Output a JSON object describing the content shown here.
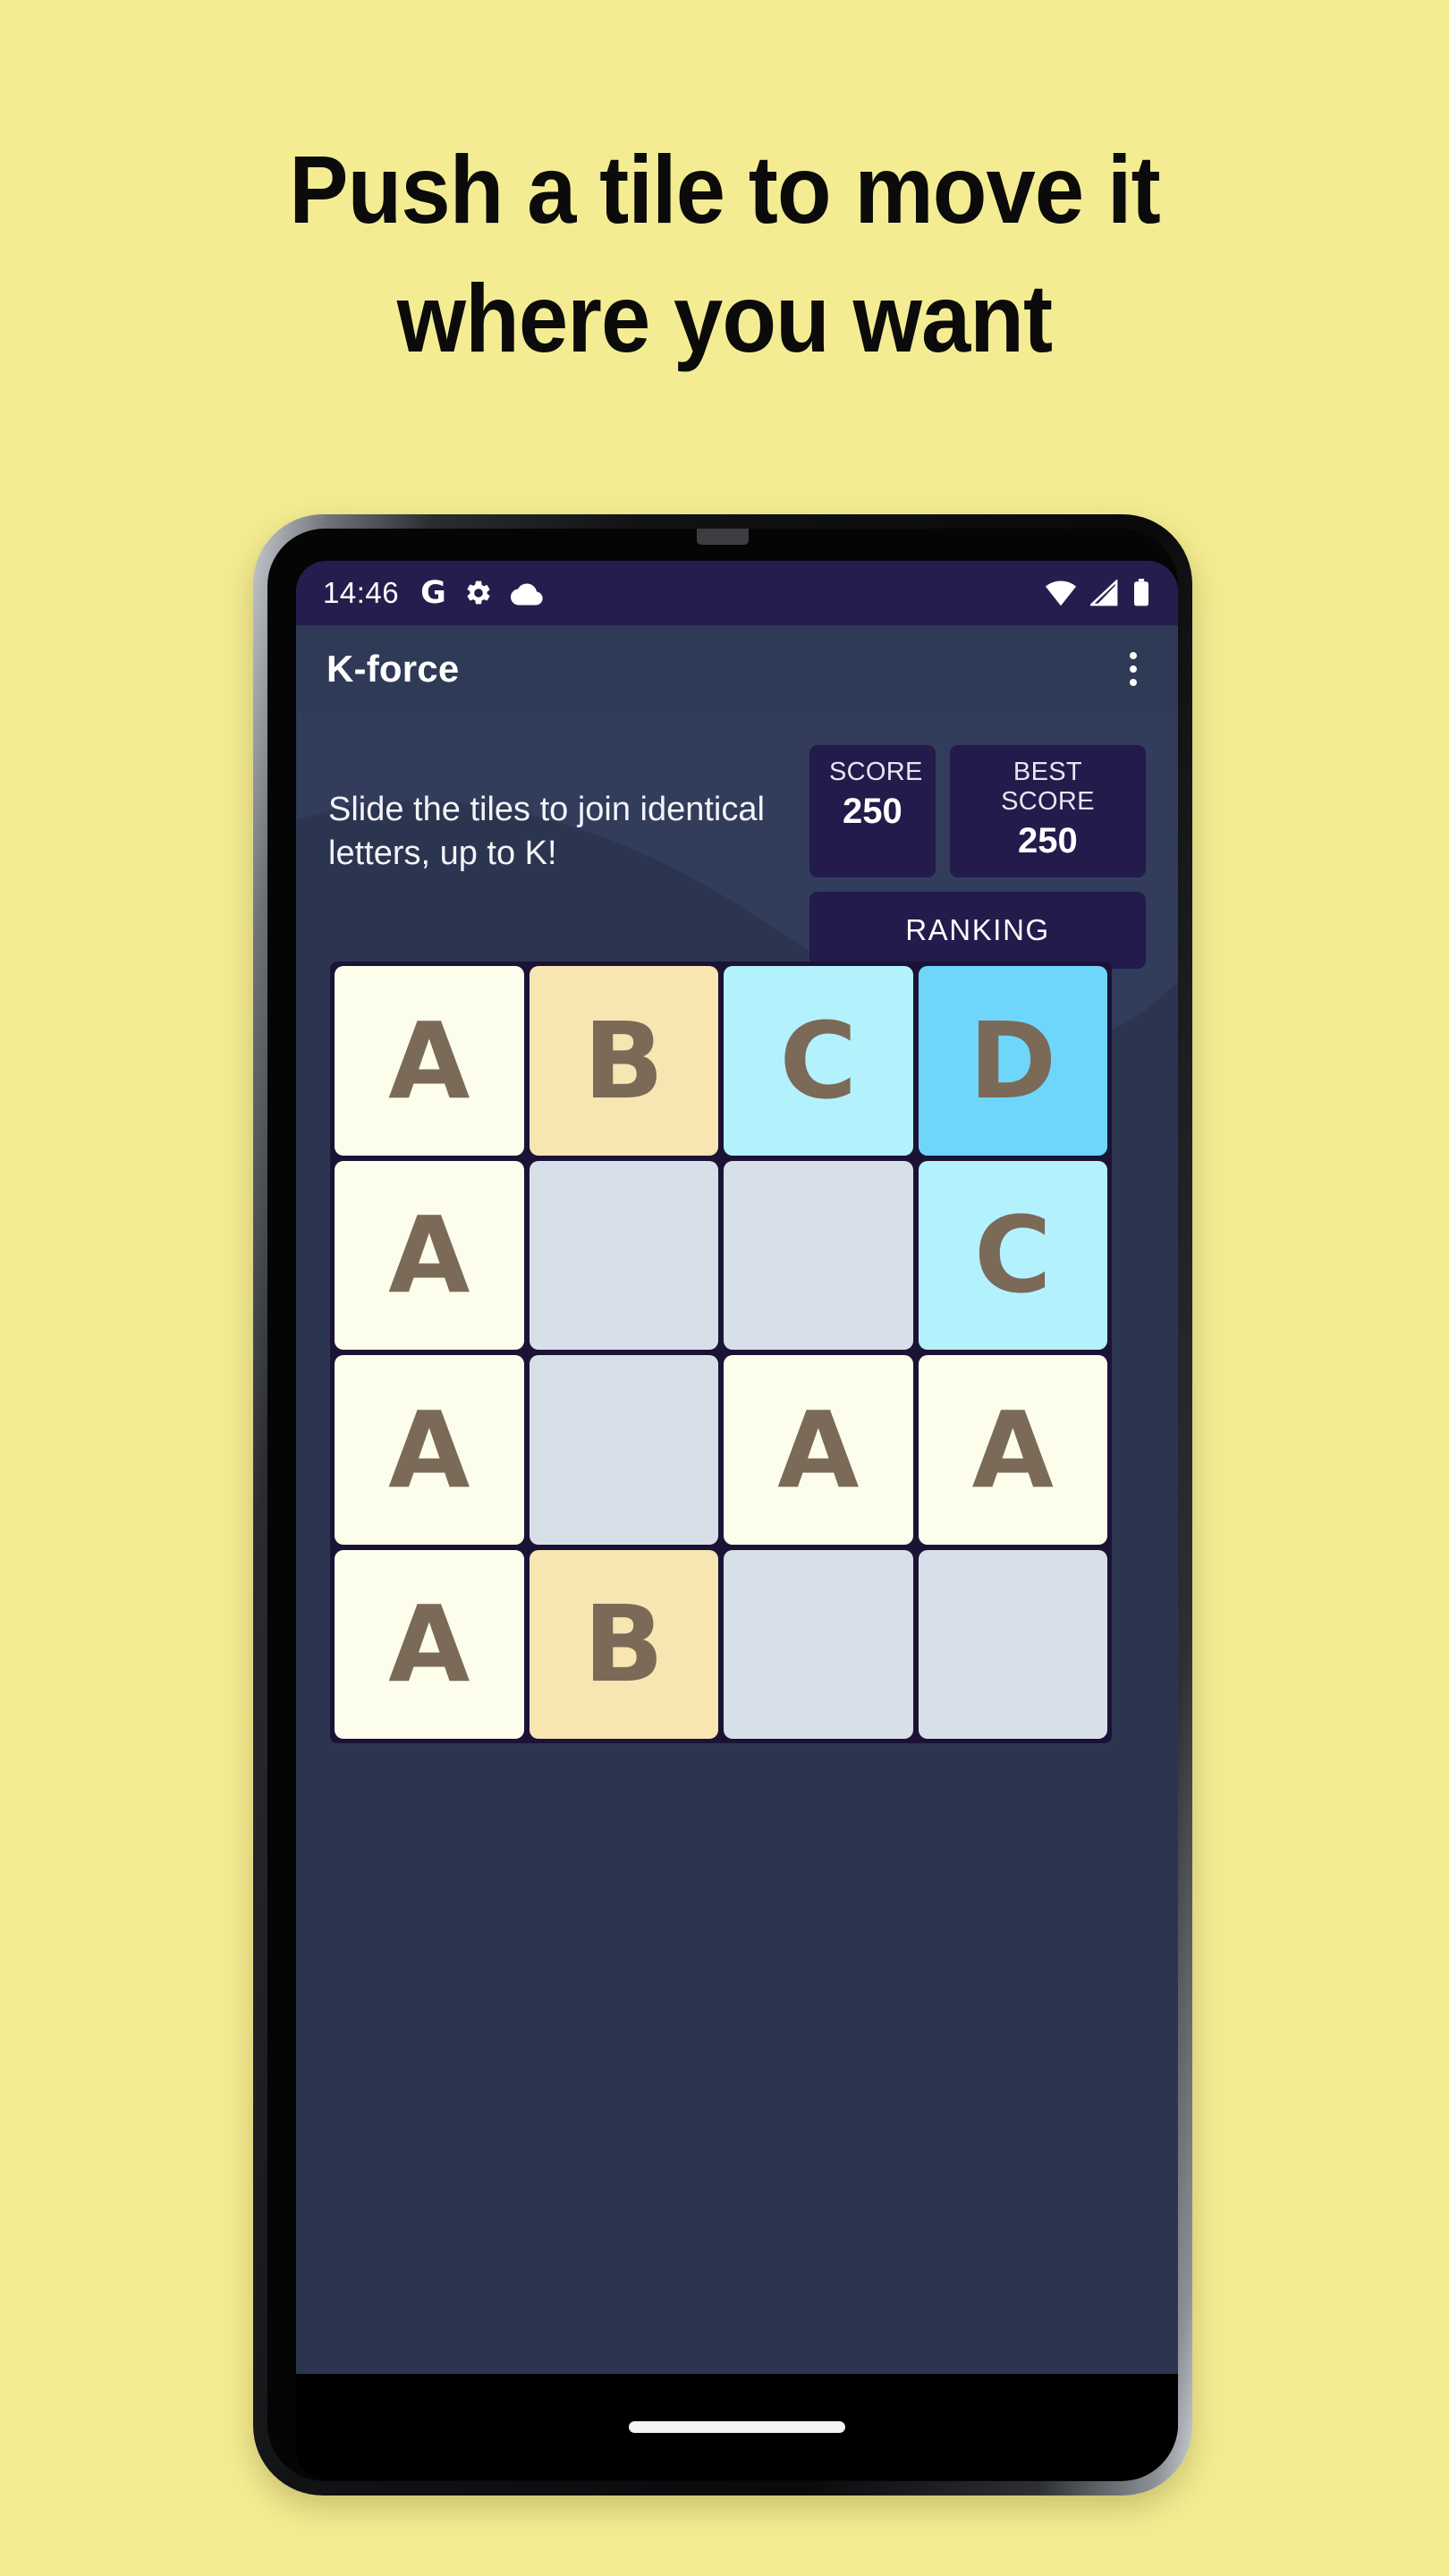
{
  "page": {
    "background_color": "#f4ec92",
    "headline_lines": [
      "Push a tile to move it",
      "where you want"
    ]
  },
  "phone": {
    "side_buttons": [
      "power-button",
      "volume-rocker"
    ],
    "gesture_pill": "home-indicator"
  },
  "status_bar": {
    "time": "14:46",
    "left_icons": [
      "google-g-icon",
      "gear-icon",
      "cloud-icon"
    ],
    "right_icons": [
      "wifi-icon",
      "cellular-signal-icon",
      "battery-icon"
    ],
    "background_color": "#241e4e"
  },
  "app_bar": {
    "title": "K-force",
    "overflow_menu": "more-options-icon",
    "background_color": "#2f3a57"
  },
  "header": {
    "intro_text": "Slide the tiles to join identical letters, up to K!",
    "score": {
      "label": "SCORE",
      "value": "250"
    },
    "best_score": {
      "label": "BEST SCORE",
      "value": "250"
    },
    "ranking_label": "RANKING",
    "box_color": "#221b4c"
  },
  "board": {
    "background_color": "#1b1336",
    "letter_color": "#7a6a57",
    "empty_color": "#d7dfe9",
    "rows": 4,
    "columns": 4,
    "tiles": [
      {
        "letter": "A",
        "color": "#fdfdec"
      },
      {
        "letter": "B",
        "color": "#f7e6b1"
      },
      {
        "letter": "C",
        "color": "#b3f1fd"
      },
      {
        "letter": "D",
        "color": "#6fd6fb"
      },
      {
        "letter": "A",
        "color": "#fdfdec"
      },
      {
        "letter": "",
        "color": "#d7dfe9"
      },
      {
        "letter": "",
        "color": "#d7dfe9"
      },
      {
        "letter": "C",
        "color": "#b3f1fd"
      },
      {
        "letter": "A",
        "color": "#fdfdec"
      },
      {
        "letter": "",
        "color": "#d7dfe9"
      },
      {
        "letter": "A",
        "color": "#fdfdec"
      },
      {
        "letter": "A",
        "color": "#fdfdec"
      },
      {
        "letter": "A",
        "color": "#fdfdec"
      },
      {
        "letter": "B",
        "color": "#f7e6b1"
      },
      {
        "letter": "",
        "color": "#d7dfe9"
      },
      {
        "letter": "",
        "color": "#d7dfe9"
      }
    ]
  }
}
